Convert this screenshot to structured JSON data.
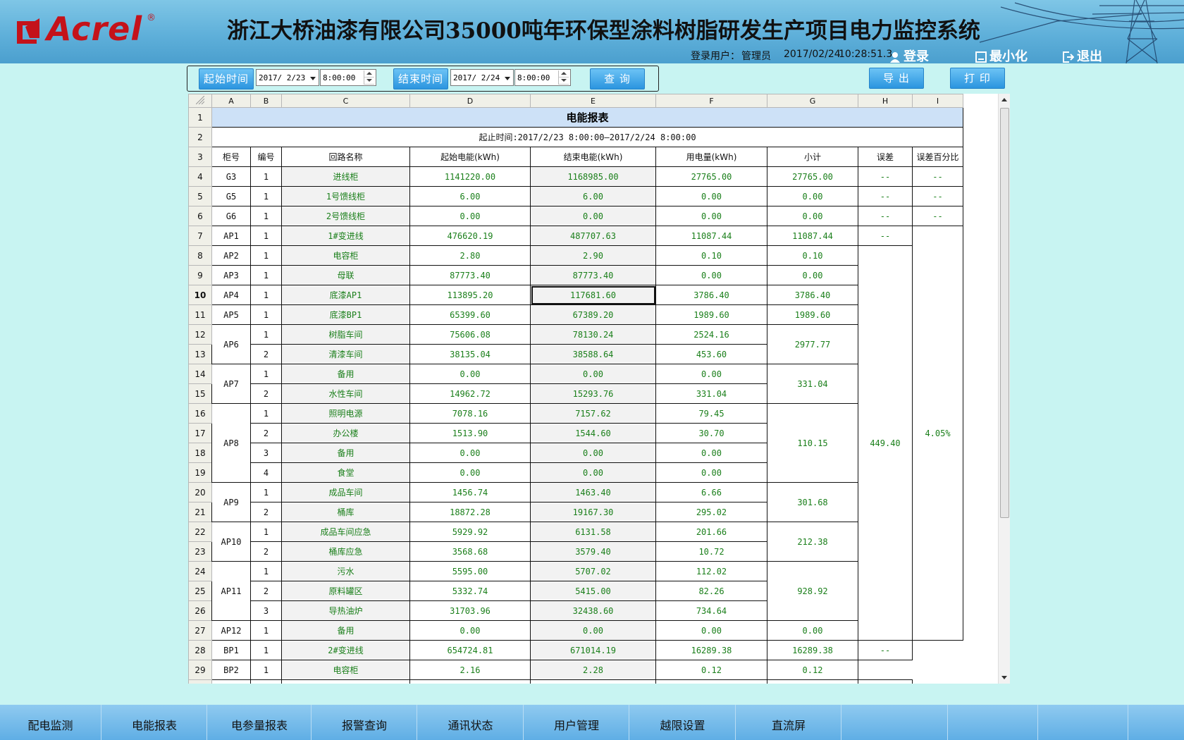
{
  "header": {
    "logo_text": "Acrel",
    "logo_reg": "®",
    "title": "浙江大桥油漆有限公司35000吨年环保型涂料树脂研发生产项目电力监控系统",
    "user_label": "登录用户：",
    "user_name": "管理员",
    "date": "2017/02/24",
    "time": "10:28:51.3",
    "login": "登录",
    "minimize": "最小化",
    "logout": "退出"
  },
  "toolbar": {
    "start_label": "起始时间",
    "start_date": "2017/ 2/23",
    "start_time": "8:00:00",
    "end_label": "结束时间",
    "end_date": "2017/ 2/24",
    "end_time": "8:00:00",
    "query": "查 询",
    "export": "导 出",
    "print": "打 印"
  },
  "sheet": {
    "col_letters": [
      "A",
      "B",
      "C",
      "D",
      "E",
      "F",
      "G",
      "H",
      "I"
    ],
    "row_numbers": [
      "1",
      "2",
      "3",
      "4",
      "5",
      "6",
      "7",
      "8",
      "9",
      "10",
      "11",
      "12",
      "13",
      "14",
      "15",
      "16",
      "17",
      "18",
      "19",
      "20",
      "21",
      "22",
      "23",
      "24",
      "25",
      "26",
      "27",
      "28",
      "29"
    ],
    "title": "电能报表",
    "period": "起止时间:2017/2/23 8:00:00—2017/2/24 8:00:00",
    "headers": [
      "柜号",
      "编号",
      "回路名称",
      "起始电能(kWh)",
      "结束电能(kWh)",
      "用电量(kWh)",
      "小计",
      "误差",
      "误差百分比"
    ],
    "rows": [
      {
        "cab": "G3",
        "no": "1",
        "name": "进线柜",
        "start": "1141220.00",
        "end": "1168985.00",
        "use": "27765.00",
        "sub": "27765.00",
        "err": "--",
        "pct": "--"
      },
      {
        "cab": "G5",
        "no": "1",
        "name": "1号馈线柜",
        "start": "6.00",
        "end": "6.00",
        "use": "0.00",
        "sub": "0.00",
        "err": "--",
        "pct": "--"
      },
      {
        "cab": "G6",
        "no": "1",
        "name": "2号馈线柜",
        "start": "0.00",
        "end": "0.00",
        "use": "0.00",
        "sub": "0.00",
        "err": "--",
        "pct": "--"
      },
      {
        "cab": "AP1",
        "no": "1",
        "name": "1#变进线",
        "start": "476620.19",
        "end": "487707.63",
        "use": "11087.44",
        "sub": "11087.44",
        "err": "--",
        "pct": "4.05%"
      },
      {
        "cab": "AP2",
        "no": "1",
        "name": "电容柜",
        "start": "2.80",
        "end": "2.90",
        "use": "0.10",
        "sub": "0.10",
        "err": "449.40"
      },
      {
        "cab": "AP3",
        "no": "1",
        "name": "母联",
        "start": "87773.40",
        "end": "87773.40",
        "use": "0.00",
        "sub": "0.00"
      },
      {
        "cab": "AP4",
        "no": "1",
        "name": "底漆AP1",
        "start": "113895.20",
        "end": "117681.60",
        "use": "3786.40",
        "sub": "3786.40"
      },
      {
        "cab": "AP5",
        "no": "1",
        "name": "底漆BP1",
        "start": "65399.60",
        "end": "67389.20",
        "use": "1989.60",
        "sub": "1989.60"
      },
      {
        "cab": "AP6",
        "no": "1",
        "name": "树脂车间",
        "start": "75606.08",
        "end": "78130.24",
        "use": "2524.16",
        "sub": "2977.77"
      },
      {
        "no": "2",
        "name": "清漆车间",
        "start": "38135.04",
        "end": "38588.64",
        "use": "453.60"
      },
      {
        "cab": "AP7",
        "no": "1",
        "name": "备用",
        "start": "0.00",
        "end": "0.00",
        "use": "0.00",
        "sub": "331.04"
      },
      {
        "no": "2",
        "name": "水性车间",
        "start": "14962.72",
        "end": "15293.76",
        "use": "331.04"
      },
      {
        "cab": "AP8",
        "no": "1",
        "name": "照明电源",
        "start": "7078.16",
        "end": "7157.62",
        "use": "79.45",
        "sub": "110.15"
      },
      {
        "no": "2",
        "name": "办公楼",
        "start": "1513.90",
        "end": "1544.60",
        "use": "30.70"
      },
      {
        "no": "3",
        "name": "备用",
        "start": "0.00",
        "end": "0.00",
        "use": "0.00"
      },
      {
        "no": "4",
        "name": "食堂",
        "start": "0.00",
        "end": "0.00",
        "use": "0.00"
      },
      {
        "cab": "AP9",
        "no": "1",
        "name": "成品车间",
        "start": "1456.74",
        "end": "1463.40",
        "use": "6.66",
        "sub": "301.68"
      },
      {
        "no": "2",
        "name": "桶库",
        "start": "18872.28",
        "end": "19167.30",
        "use": "295.02"
      },
      {
        "cab": "AP10",
        "no": "1",
        "name": "成品车间应急",
        "start": "5929.92",
        "end": "6131.58",
        "use": "201.66",
        "sub": "212.38"
      },
      {
        "no": "2",
        "name": "桶库应急",
        "start": "3568.68",
        "end": "3579.40",
        "use": "10.72"
      },
      {
        "cab": "AP11",
        "no": "1",
        "name": "污水",
        "start": "5595.00",
        "end": "5707.02",
        "use": "112.02",
        "sub": "928.92"
      },
      {
        "no": "2",
        "name": "原料罐区",
        "start": "5332.74",
        "end": "5415.00",
        "use": "82.26"
      },
      {
        "no": "3",
        "name": "导热油炉",
        "start": "31703.96",
        "end": "32438.60",
        "use": "734.64"
      },
      {
        "cab": "AP12",
        "no": "1",
        "name": "备用",
        "start": "0.00",
        "end": "0.00",
        "use": "0.00",
        "sub": "0.00"
      },
      {
        "cab": "BP1",
        "no": "1",
        "name": "2#变进线",
        "start": "654724.81",
        "end": "671014.19",
        "use": "16289.38",
        "sub": "16289.38",
        "err": "--"
      },
      {
        "cab": "BP2",
        "no": "1",
        "name": "电容柜",
        "start": "2.16",
        "end": "2.28",
        "use": "0.12",
        "sub": "0.12"
      }
    ]
  },
  "nav": {
    "items": [
      "配电监测",
      "电能报表",
      "电参量报表",
      "报警查询",
      "通讯状态",
      "用户管理",
      "越限设置",
      "直流屏",
      "",
      "",
      "",
      ""
    ]
  }
}
